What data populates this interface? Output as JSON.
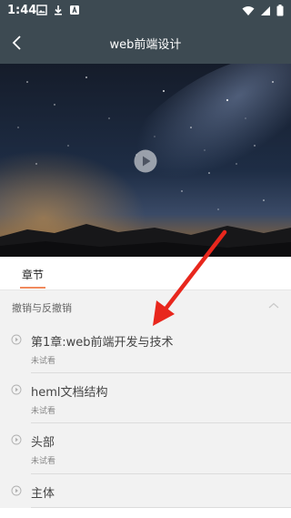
{
  "status_bar": {
    "time": "1:44"
  },
  "header": {
    "title": "web前端设计"
  },
  "tabs": {
    "chapter_label": "章节"
  },
  "section": {
    "title": "撤销与反撤销"
  },
  "lessons": [
    {
      "title": "第1章:web前端开发与技术",
      "status": "未试看"
    },
    {
      "title": "heml文档结构",
      "status": "未试看"
    },
    {
      "title": "头部",
      "status": "未试看"
    },
    {
      "title": "主体",
      "status": ""
    }
  ],
  "colors": {
    "header_bg": "#3d4a52",
    "tab_accent": "#f08a5d",
    "list_bg": "#f2f2f2",
    "arrow": "#e8271d"
  },
  "icons": [
    "image-icon",
    "download-icon",
    "app-icon",
    "wifi-icon",
    "signal-icon",
    "battery-icon",
    "back-arrow-icon",
    "play-icon",
    "chevron-up-icon",
    "play-bullet-icon"
  ]
}
